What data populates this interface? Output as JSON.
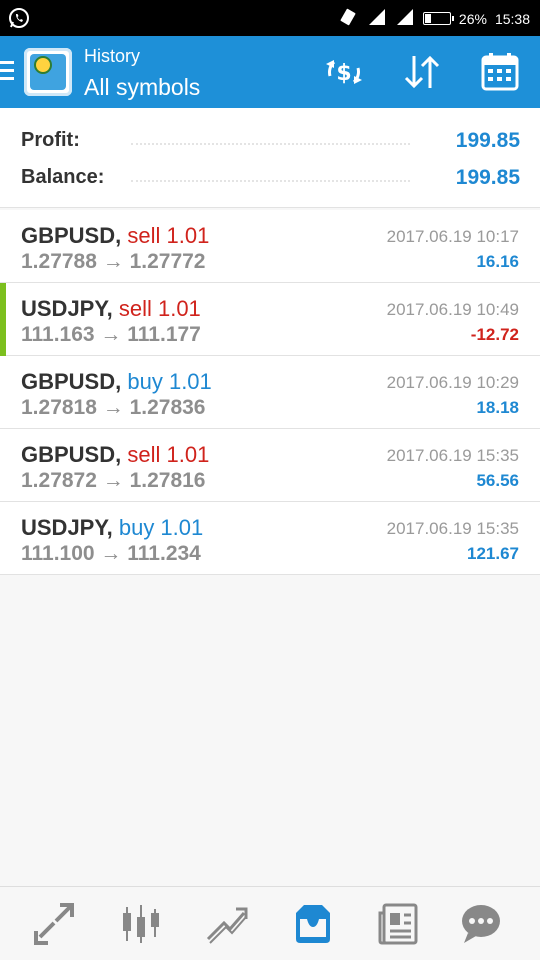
{
  "status_bar": {
    "battery": "26%",
    "battery_level": 0.26,
    "time": "15:38",
    "left_icon": "whatsapp-icon",
    "right_icons": [
      "vibrate-icon",
      "signal-icon",
      "signal-icon",
      "battery-icon"
    ]
  },
  "toolbar": {
    "subtitle": "History",
    "title": "All symbols",
    "actions": [
      "currency-swap-icon",
      "sort-icon",
      "calendar-icon"
    ]
  },
  "summary": {
    "profit_label": "Profit:",
    "profit_value": "199.85",
    "balance_label": "Balance:",
    "balance_value": "199.85"
  },
  "trades": [
    {
      "symbol": "GBPUSD,",
      "side": "sell 1.01",
      "type": "sell",
      "prices": "1.27788 → 1.27772",
      "time": "2017.06.19 10:17",
      "profit": "16.16",
      "profit_sign": "positive",
      "selected": false
    },
    {
      "symbol": "USDJPY,",
      "side": "sell 1.01",
      "type": "sell",
      "prices": "111.163 → 111.177",
      "time": "2017.06.19 10:49",
      "profit": "-12.72",
      "profit_sign": "negative",
      "selected": true
    },
    {
      "symbol": "GBPUSD,",
      "side": "buy 1.01",
      "type": "buy",
      "prices": "1.27818 → 1.27836",
      "time": "2017.06.19 10:29",
      "profit": "18.18",
      "profit_sign": "positive",
      "selected": false
    },
    {
      "symbol": "GBPUSD,",
      "side": "sell 1.01",
      "type": "sell",
      "prices": "1.27872 → 1.27816",
      "time": "2017.06.19 15:35",
      "profit": "56.56",
      "profit_sign": "positive",
      "selected": false
    },
    {
      "symbol": "USDJPY,",
      "side": "buy 1.01",
      "type": "buy",
      "prices": "111.100 → 111.234",
      "time": "2017.06.19 15:35",
      "profit": "121.67",
      "profit_sign": "positive",
      "selected": false
    }
  ],
  "bottom_nav": [
    "quotes-icon",
    "chart-icon",
    "trade-icon",
    "history-icon",
    "news-icon",
    "chat-icon"
  ],
  "bottom_nav_active": "history-icon",
  "colors": {
    "accent": "#1e90d8",
    "sell": "#d0231c",
    "buy": "#1e88d2",
    "selected_marker": "#7cbf1e"
  }
}
